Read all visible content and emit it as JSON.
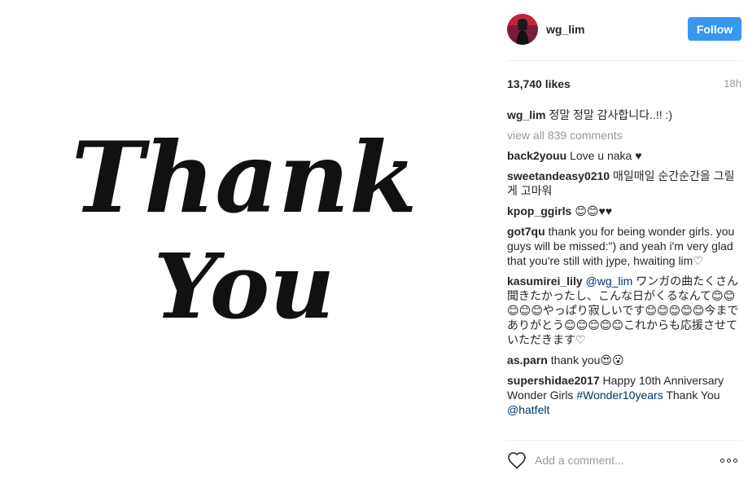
{
  "post_image": {
    "line1": "Thank",
    "line2": "You"
  },
  "header": {
    "username": "wg_lim",
    "follow_label": "Follow"
  },
  "stats": {
    "likes": "13,740 likes",
    "time": "18h"
  },
  "caption": {
    "user": "wg_lim",
    "text": "정말 정말 감사합니다..!! :)"
  },
  "view_all": "view all 839 comments",
  "comments": [
    {
      "user": "back2youu",
      "text": "Love u naka ♥"
    },
    {
      "user": "sweetandeasy0210",
      "text": "매일매일 순간순간을 그릴게 고마워"
    },
    {
      "user": "kpop_ggirls",
      "text": "😊😊♥♥"
    },
    {
      "user": "got7qu",
      "text": "thank you for being wonder girls. you guys will be missed:\") and yeah i'm very glad that you're still with jype, hwaiting lim♡"
    },
    {
      "user": "kasumirei_lily",
      "mention": "@wg_lim",
      "text": "ワンガの曲たくさん聞きたかったし、こんな日がくるなんて😊😊😊😊😊やっぱり寂しいです😊😊😊😊😊今までありがとう😊😊😊😊😊これからも応援させていただきます♡"
    },
    {
      "user": "as.parn",
      "text": "thank you😍😮"
    },
    {
      "user": "supershidae2017",
      "text_before": "Happy 10th Anniversary Wonder Girls",
      "hashtag": "#Wonder10years",
      "text_middle": "Thank You",
      "mention": "@hatfelt"
    }
  ],
  "add_comment": {
    "placeholder": "Add a comment..."
  },
  "colors": {
    "follow_button": "#3897f0",
    "link": "#003569",
    "muted": "#999999"
  },
  "icons": {
    "like": "heart-outline-icon",
    "more": "more-options-icon"
  }
}
